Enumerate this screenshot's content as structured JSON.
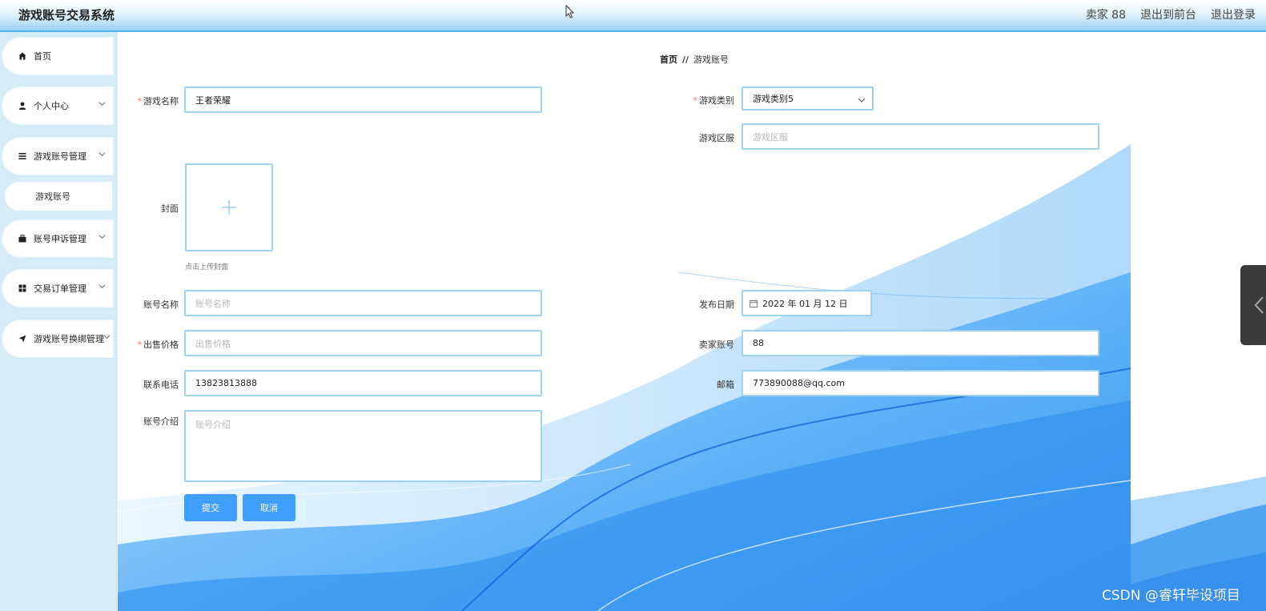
{
  "app": {
    "title": "游戏账号交易系统"
  },
  "header": {
    "user": "卖家 88",
    "front": "退出到前台",
    "logout": "退出登录"
  },
  "sidebar": {
    "items": [
      {
        "label": "首页",
        "icon": "home-icon"
      },
      {
        "label": "个人中心",
        "icon": "user-icon"
      },
      {
        "label": "游戏账号管理",
        "icon": "list-icon"
      },
      {
        "label": "账号申诉管理",
        "icon": "briefcase-icon"
      },
      {
        "label": "交易订单管理",
        "icon": "grid-icon"
      },
      {
        "label": "游戏账号换绑管理",
        "icon": "send-icon"
      }
    ],
    "sub_item": "游戏账号"
  },
  "breadcrumb": {
    "home": "首页",
    "sep": "//",
    "current": "游戏账号"
  },
  "form": {
    "game_name": {
      "label": "游戏名称",
      "value": "王者荣耀"
    },
    "game_category": {
      "label": "游戏类别",
      "value": "游戏类别5"
    },
    "game_server": {
      "label": "游戏区服",
      "placeholder": "游戏区服"
    },
    "cover": {
      "label": "封面",
      "hint": "点击上传封面"
    },
    "account_name": {
      "label": "账号名称",
      "placeholder": "账号名称"
    },
    "publish_date": {
      "label": "发布日期",
      "value": "2022 年 01 月 12 日"
    },
    "price": {
      "label": "出售价格",
      "placeholder": "出售价格"
    },
    "seller_account": {
      "label": "卖家账号",
      "value": "88"
    },
    "phone": {
      "label": "联系电话",
      "value": "13823813888"
    },
    "email": {
      "label": "邮箱",
      "value": "773890088@qq.com"
    },
    "intro": {
      "label": "账号介绍",
      "placeholder": "账号介绍"
    },
    "submit": "提交",
    "cancel": "取消"
  },
  "watermark": "CSDN @睿轩毕设项目",
  "colors": {
    "primary": "#409eff",
    "header_bottom": "#5ab6ea",
    "sidebar_bg": "#d6edf8",
    "input_border": "#9fd2ee"
  }
}
